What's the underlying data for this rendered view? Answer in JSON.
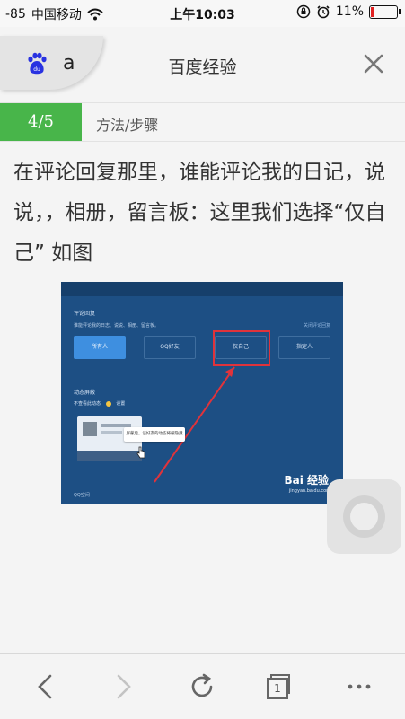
{
  "status_bar": {
    "signal": "-85",
    "carrier": "中国移动",
    "time": "上午10:03",
    "battery": "11%",
    "battery_level": 0.11
  },
  "header": {
    "tab_text": "a",
    "title": "百度经验"
  },
  "step": {
    "counter": "4/5",
    "label": "方法/步骤"
  },
  "content": {
    "text": "在评论回复那里，谁能评论我的日记，说说，，相册，留言板：这里我们选择“仅自己” 如图"
  },
  "screenshot": {
    "section_title": "评论回复",
    "section_desc": "谁能评论我的日志、说说、相册、留言板。",
    "link": "关闭评论回复",
    "options": [
      "所有人",
      "QQ好友",
      "仅自己",
      "指定人"
    ],
    "selected_option": "所有人",
    "highlighted_option": "仅自己",
    "feed_section": "动态屏蔽",
    "feed_desc": "不查看此动态",
    "feed_link": "设置",
    "tooltip": "屏蔽后，该好友的动态将被隐藏",
    "watermark": "Bai 经验",
    "watermark_url": "jingyan.baidu.com",
    "footer": "QQ空间"
  },
  "toolbar": {
    "tab_count": "1"
  },
  "colors": {
    "accent_green": "#48b54a",
    "highlight_red": "#e0333b",
    "panel_blue": "#1d4f84"
  }
}
